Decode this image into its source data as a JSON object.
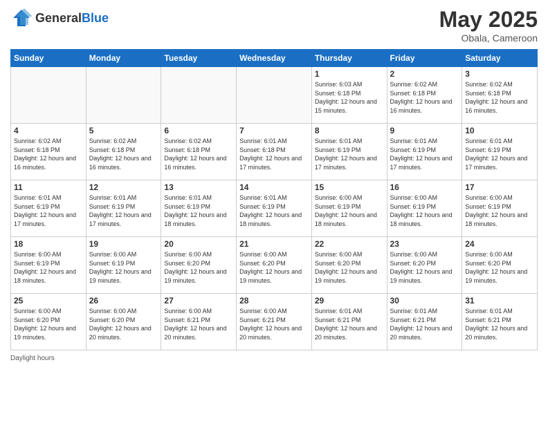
{
  "header": {
    "logo_general": "General",
    "logo_blue": "Blue",
    "month_year": "May 2025",
    "location": "Obala, Cameroon"
  },
  "days_of_week": [
    "Sunday",
    "Monday",
    "Tuesday",
    "Wednesday",
    "Thursday",
    "Friday",
    "Saturday"
  ],
  "legend": {
    "daylight_hours": "Daylight hours"
  },
  "weeks": [
    [
      {
        "day": "",
        "info": ""
      },
      {
        "day": "",
        "info": ""
      },
      {
        "day": "",
        "info": ""
      },
      {
        "day": "",
        "info": ""
      },
      {
        "day": "1",
        "info": "Sunrise: 6:03 AM\nSunset: 6:18 PM\nDaylight: 12 hours and 15 minutes."
      },
      {
        "day": "2",
        "info": "Sunrise: 6:02 AM\nSunset: 6:18 PM\nDaylight: 12 hours and 16 minutes."
      },
      {
        "day": "3",
        "info": "Sunrise: 6:02 AM\nSunset: 6:18 PM\nDaylight: 12 hours and 16 minutes."
      }
    ],
    [
      {
        "day": "4",
        "info": "Sunrise: 6:02 AM\nSunset: 6:18 PM\nDaylight: 12 hours and 16 minutes."
      },
      {
        "day": "5",
        "info": "Sunrise: 6:02 AM\nSunset: 6:18 PM\nDaylight: 12 hours and 16 minutes."
      },
      {
        "day": "6",
        "info": "Sunrise: 6:02 AM\nSunset: 6:18 PM\nDaylight: 12 hours and 16 minutes."
      },
      {
        "day": "7",
        "info": "Sunrise: 6:01 AM\nSunset: 6:18 PM\nDaylight: 12 hours and 17 minutes."
      },
      {
        "day": "8",
        "info": "Sunrise: 6:01 AM\nSunset: 6:19 PM\nDaylight: 12 hours and 17 minutes."
      },
      {
        "day": "9",
        "info": "Sunrise: 6:01 AM\nSunset: 6:19 PM\nDaylight: 12 hours and 17 minutes."
      },
      {
        "day": "10",
        "info": "Sunrise: 6:01 AM\nSunset: 6:19 PM\nDaylight: 12 hours and 17 minutes."
      }
    ],
    [
      {
        "day": "11",
        "info": "Sunrise: 6:01 AM\nSunset: 6:19 PM\nDaylight: 12 hours and 17 minutes."
      },
      {
        "day": "12",
        "info": "Sunrise: 6:01 AM\nSunset: 6:19 PM\nDaylight: 12 hours and 17 minutes."
      },
      {
        "day": "13",
        "info": "Sunrise: 6:01 AM\nSunset: 6:19 PM\nDaylight: 12 hours and 18 minutes."
      },
      {
        "day": "14",
        "info": "Sunrise: 6:01 AM\nSunset: 6:19 PM\nDaylight: 12 hours and 18 minutes."
      },
      {
        "day": "15",
        "info": "Sunrise: 6:00 AM\nSunset: 6:19 PM\nDaylight: 12 hours and 18 minutes."
      },
      {
        "day": "16",
        "info": "Sunrise: 6:00 AM\nSunset: 6:19 PM\nDaylight: 12 hours and 18 minutes."
      },
      {
        "day": "17",
        "info": "Sunrise: 6:00 AM\nSunset: 6:19 PM\nDaylight: 12 hours and 18 minutes."
      }
    ],
    [
      {
        "day": "18",
        "info": "Sunrise: 6:00 AM\nSunset: 6:19 PM\nDaylight: 12 hours and 18 minutes."
      },
      {
        "day": "19",
        "info": "Sunrise: 6:00 AM\nSunset: 6:19 PM\nDaylight: 12 hours and 19 minutes."
      },
      {
        "day": "20",
        "info": "Sunrise: 6:00 AM\nSunset: 6:20 PM\nDaylight: 12 hours and 19 minutes."
      },
      {
        "day": "21",
        "info": "Sunrise: 6:00 AM\nSunset: 6:20 PM\nDaylight: 12 hours and 19 minutes."
      },
      {
        "day": "22",
        "info": "Sunrise: 6:00 AM\nSunset: 6:20 PM\nDaylight: 12 hours and 19 minutes."
      },
      {
        "day": "23",
        "info": "Sunrise: 6:00 AM\nSunset: 6:20 PM\nDaylight: 12 hours and 19 minutes."
      },
      {
        "day": "24",
        "info": "Sunrise: 6:00 AM\nSunset: 6:20 PM\nDaylight: 12 hours and 19 minutes."
      }
    ],
    [
      {
        "day": "25",
        "info": "Sunrise: 6:00 AM\nSunset: 6:20 PM\nDaylight: 12 hours and 19 minutes."
      },
      {
        "day": "26",
        "info": "Sunrise: 6:00 AM\nSunset: 6:20 PM\nDaylight: 12 hours and 20 minutes."
      },
      {
        "day": "27",
        "info": "Sunrise: 6:00 AM\nSunset: 6:21 PM\nDaylight: 12 hours and 20 minutes."
      },
      {
        "day": "28",
        "info": "Sunrise: 6:00 AM\nSunset: 6:21 PM\nDaylight: 12 hours and 20 minutes."
      },
      {
        "day": "29",
        "info": "Sunrise: 6:01 AM\nSunset: 6:21 PM\nDaylight: 12 hours and 20 minutes."
      },
      {
        "day": "30",
        "info": "Sunrise: 6:01 AM\nSunset: 6:21 PM\nDaylight: 12 hours and 20 minutes."
      },
      {
        "day": "31",
        "info": "Sunrise: 6:01 AM\nSunset: 6:21 PM\nDaylight: 12 hours and 20 minutes."
      }
    ]
  ]
}
